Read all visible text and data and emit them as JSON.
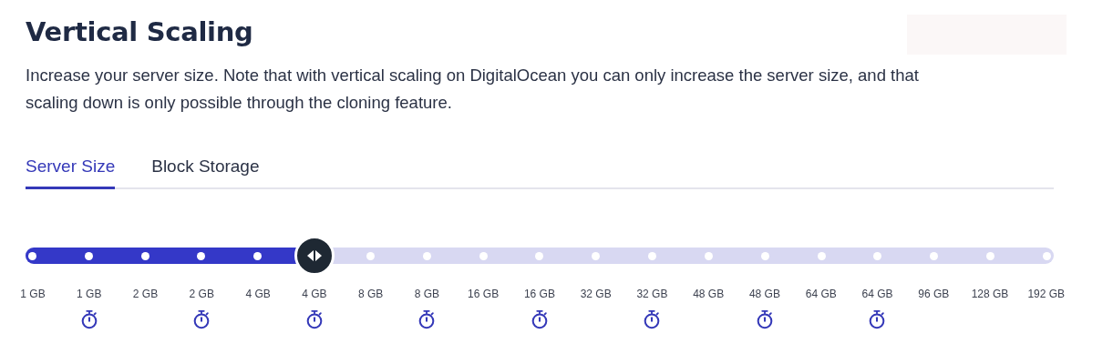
{
  "title": "Vertical Scaling",
  "description": "Increase your server size. Note that with vertical scaling on DigitalOcean you can only increase the server size, and that scaling down is only possible through the cloning feature.",
  "tabs": [
    {
      "label": "Server Size",
      "selected": true
    },
    {
      "label": "Block Storage",
      "selected": false
    }
  ],
  "slider": {
    "level": 0.2778,
    "stops": [
      {
        "label": "1 GB",
        "timer": false
      },
      {
        "label": "1 GB",
        "timer": true
      },
      {
        "label": "2 GB",
        "timer": false
      },
      {
        "label": "2 GB",
        "timer": true
      },
      {
        "label": "4 GB",
        "timer": false
      },
      {
        "label": "4 GB",
        "timer": true
      },
      {
        "label": "8 GB",
        "timer": false
      },
      {
        "label": "8 GB",
        "timer": true
      },
      {
        "label": "16 GB",
        "timer": false
      },
      {
        "label": "16 GB",
        "timer": true
      },
      {
        "label": "32 GB",
        "timer": false
      },
      {
        "label": "32 GB",
        "timer": true
      },
      {
        "label": "48 GB",
        "timer": false
      },
      {
        "label": "48 GB",
        "timer": true
      },
      {
        "label": "64 GB",
        "timer": false
      },
      {
        "label": "64 GB",
        "timer": true
      },
      {
        "label": "96 GB",
        "timer": false
      },
      {
        "label": "128 GB",
        "timer": false
      },
      {
        "label": "192 GB",
        "timer": false
      }
    ]
  }
}
